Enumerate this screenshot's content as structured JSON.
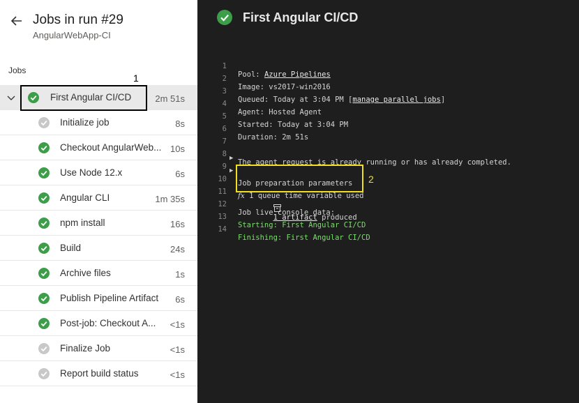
{
  "header": {
    "title": "Jobs in run #29",
    "subtitle": "AngularWebApp-CI",
    "jobs_heading": "Jobs"
  },
  "callouts": {
    "one": "1",
    "two": "2"
  },
  "colors": {
    "success": "#3d9e4a",
    "skipped": "#c8c8c8",
    "callout1": "#000000",
    "callout2": "#f1e11a"
  },
  "jobs": [
    {
      "label": "First Angular CI/CD",
      "duration": "2m 51s",
      "status": "success"
    },
    {
      "label": "Initialize job",
      "duration": "8s",
      "status": "skipped"
    },
    {
      "label": "Checkout AngularWeb...",
      "duration": "10s",
      "status": "success"
    },
    {
      "label": "Use Node 12.x",
      "duration": "6s",
      "status": "success"
    },
    {
      "label": "Angular CLI",
      "duration": "1m 35s",
      "status": "success"
    },
    {
      "label": "npm install",
      "duration": "16s",
      "status": "success"
    },
    {
      "label": "Build",
      "duration": "24s",
      "status": "success"
    },
    {
      "label": "Archive files",
      "duration": "1s",
      "status": "success"
    },
    {
      "label": "Publish Pipeline Artifact",
      "duration": "6s",
      "status": "success"
    },
    {
      "label": "Post-job: Checkout A...",
      "duration": "<1s",
      "status": "success"
    },
    {
      "label": "Finalize Job",
      "duration": "<1s",
      "status": "skipped"
    },
    {
      "label": "Report build status",
      "duration": "<1s",
      "status": "skipped"
    }
  ],
  "log": {
    "title": "First Angular CI/CD",
    "lines": [
      {
        "n": "1",
        "a": "Pool: ",
        "link": "Azure Pipelines"
      },
      {
        "n": "2",
        "a": "Image: vs2017-win2016"
      },
      {
        "n": "3",
        "a": "Queued: Today at 3:04 PM [",
        "link": "manage parallel jobs",
        "b": "]"
      },
      {
        "n": "4",
        "a": "Agent: Hosted Agent"
      },
      {
        "n": "5",
        "a": "Started: Today at 3:04 PM"
      },
      {
        "n": "6",
        "a": "Duration: 2m 51s"
      },
      {
        "n": "7",
        "a": ""
      },
      {
        "n": "8",
        "a": "The agent request is already running or has already completed."
      },
      {
        "n": "9",
        "a": "Job preparation parameters"
      },
      {
        "n": "10",
        "icon": "fx",
        "a": " 1 queue time variable used"
      },
      {
        "n": "11",
        "link": "1 artifact",
        "b": " produced"
      },
      {
        "n": "12",
        "a": "Job live console data:"
      },
      {
        "n": "13",
        "a": "Starting: First Angular CI/CD"
      },
      {
        "n": "14",
        "a": "Finishing: First Angular CI/CD"
      }
    ]
  }
}
